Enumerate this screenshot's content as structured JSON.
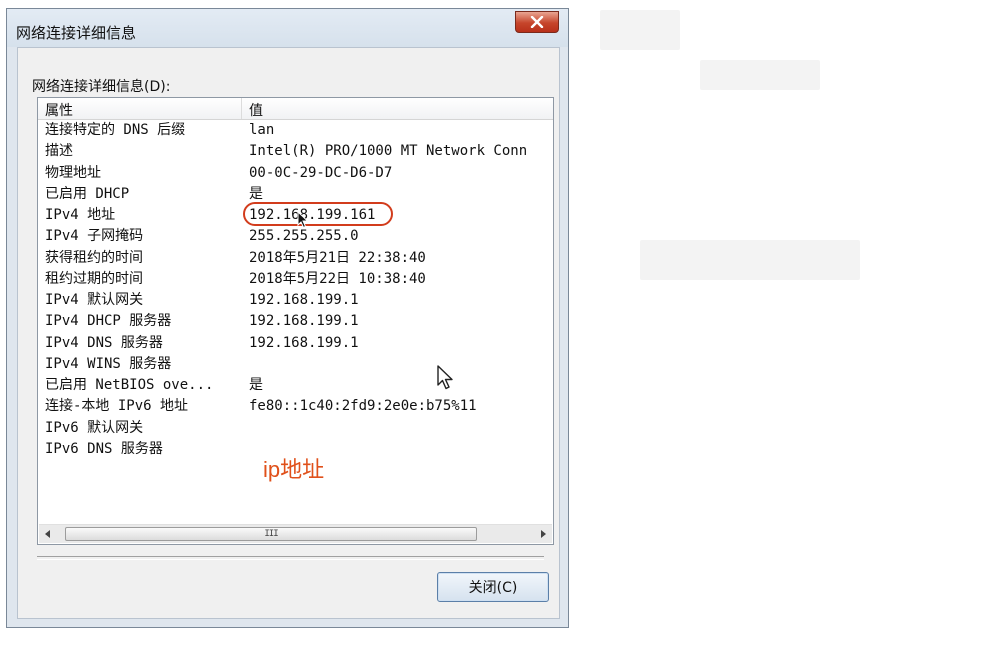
{
  "window": {
    "title": "网络连接详细信息",
    "close_icon": "close-icon"
  },
  "group_label": "网络连接详细信息(D):",
  "listview": {
    "columns": [
      "属性",
      "值"
    ],
    "rows": [
      {
        "property": "连接特定的 DNS 后缀",
        "value": "lan"
      },
      {
        "property": "描述",
        "value": "Intel(R) PRO/1000 MT Network Conn"
      },
      {
        "property": "物理地址",
        "value": "00-0C-29-DC-D6-D7"
      },
      {
        "property": "已启用 DHCP",
        "value": "是"
      },
      {
        "property": "IPv4 地址",
        "value": "192.168.199.161"
      },
      {
        "property": "IPv4 子网掩码",
        "value": "255.255.255.0"
      },
      {
        "property": "获得租约的时间",
        "value": "2018年5月21日 22:38:40"
      },
      {
        "property": "租约过期的时间",
        "value": "2018年5月22日 10:38:40"
      },
      {
        "property": "IPv4 默认网关",
        "value": "192.168.199.1"
      },
      {
        "property": "IPv4 DHCP 服务器",
        "value": "192.168.199.1"
      },
      {
        "property": "IPv4 DNS 服务器",
        "value": "192.168.199.1"
      },
      {
        "property": "IPv4 WINS 服务器",
        "value": ""
      },
      {
        "property": "已启用 NetBIOS ove...",
        "value": "是"
      },
      {
        "property": "连接-本地 IPv6 地址",
        "value": "fe80::1c40:2fd9:2e0e:b75%11"
      },
      {
        "property": "IPv6 默认网关",
        "value": ""
      },
      {
        "property": "IPv6 DNS 服务器",
        "value": ""
      }
    ],
    "scrollbar": {
      "thumb_grip": "III"
    }
  },
  "annotation": {
    "text": "ip地址",
    "color": "#e0501a"
  },
  "buttons": {
    "close_label": "关闭(C)"
  },
  "colors": {
    "close_button_red": "#c6452b",
    "annotation_oval": "#d23c1c"
  }
}
